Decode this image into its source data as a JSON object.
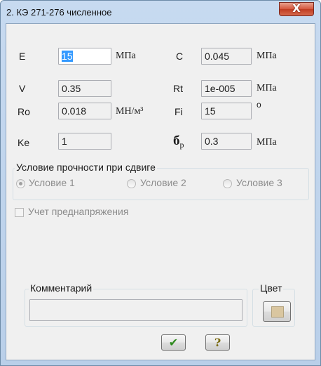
{
  "window": {
    "title": "2. КЭ 271-276 численное",
    "close_glyph": "X"
  },
  "params": {
    "e": {
      "label": "E",
      "value": "15",
      "unit": "МПа"
    },
    "v": {
      "label": "V",
      "value": "0.35",
      "unit": ""
    },
    "ro": {
      "label": "Ro",
      "value": "0.018",
      "unit": "МН/м³"
    },
    "ke": {
      "label": "Ke",
      "value": "1",
      "unit": ""
    },
    "c": {
      "label": "C",
      "value": "0.045",
      "unit": "МПа"
    },
    "rt": {
      "label": "Rt",
      "value": "1e-005",
      "unit": "МПа"
    },
    "fi": {
      "label": "Fi",
      "value": "15",
      "unit": "о"
    },
    "sigma": {
      "label_main": "б",
      "label_sub": "р",
      "value": "0.3",
      "unit": "МПа"
    }
  },
  "shear_group": {
    "title": "Условие прочности при сдвиге",
    "options": [
      "Условие 1",
      "Условие 2",
      "Условие 3"
    ],
    "selected_index": 0
  },
  "prestress": {
    "label": "Учет преднапряжения",
    "checked": false
  },
  "comment": {
    "title": "Комментарий",
    "value": ""
  },
  "color_group": {
    "title": "Цвет",
    "color": "#d9c6a0"
  },
  "buttons": {
    "ok_icon": "checkmark-icon",
    "help_icon": "question-icon",
    "ok_glyph": "✔",
    "help_glyph": "?"
  },
  "colors": {
    "title_bar": "#b9cfe9",
    "close": "#c83d22",
    "selection": "#3399ff",
    "ok_check": "#2f8a1e",
    "help_q": "#7a6a10"
  }
}
